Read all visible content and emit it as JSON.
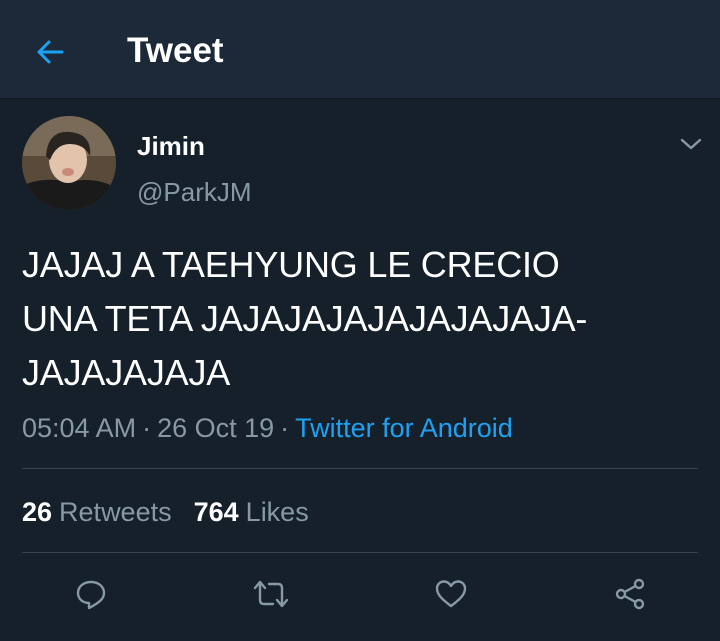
{
  "header": {
    "back_icon": "arrow-left-icon",
    "title": "Tweet"
  },
  "tweet": {
    "author": {
      "name": "Jimin",
      "handle": "@ParkJM",
      "avatar": "avatar-photo"
    },
    "more_icon": "chevron-down-icon",
    "text_lines": [
      "JAJAJ A TAEHYUNG LE CRECIO",
      "UNA TETA JAJAJAJAJAJAJAJAJA-",
      "JAJAJAJAJA"
    ],
    "time": "05:04 AM",
    "date": "26 Oct 19",
    "separator": "·",
    "source": "Twitter for Android",
    "stats": {
      "retweets_count": "26",
      "retweets_label": "Retweets",
      "likes_count": "764",
      "likes_label": "Likes"
    },
    "actions": [
      "reply-icon",
      "retweet-icon",
      "like-icon",
      "share-icon"
    ]
  },
  "colors": {
    "background": "#15202b",
    "header": "#1c2938",
    "accent": "#1da1f2",
    "text_primary": "#ffffff",
    "text_secondary": "#8899a6",
    "divider": "#38444d"
  }
}
